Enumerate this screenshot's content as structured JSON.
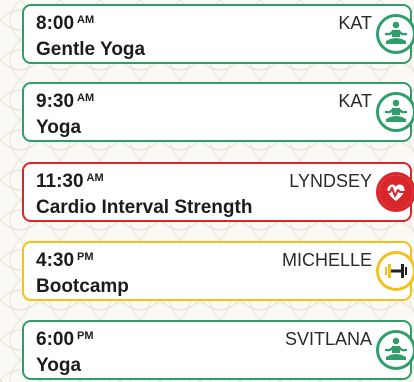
{
  "colors": {
    "green": "#2f9e6b",
    "red": "#d9262b",
    "yellow": "#f2c21b",
    "background": "#fbf9f4"
  },
  "classes": [
    {
      "time": "8:00",
      "ampm": "AM",
      "instructor": "KAT",
      "title": "Gentle Yoga",
      "status_color": "green",
      "icon": "yoga-icon"
    },
    {
      "time": "9:30",
      "ampm": "AM",
      "instructor": "KAT",
      "title": "Yoga",
      "status_color": "green",
      "icon": "yoga-icon"
    },
    {
      "time": "11:30",
      "ampm": "AM",
      "instructor": "LYNDSEY",
      "title": "Cardio Interval Strength",
      "status_color": "red",
      "icon": "heartbeat-icon"
    },
    {
      "time": "4:30",
      "ampm": "PM",
      "instructor": "MICHELLE",
      "title": "Bootcamp",
      "status_color": "yellow",
      "icon": "dumbbell-icon"
    },
    {
      "time": "6:00",
      "ampm": "PM",
      "instructor": "SVITLANA",
      "title": "Yoga",
      "status_color": "green",
      "icon": "yoga-icon"
    }
  ]
}
